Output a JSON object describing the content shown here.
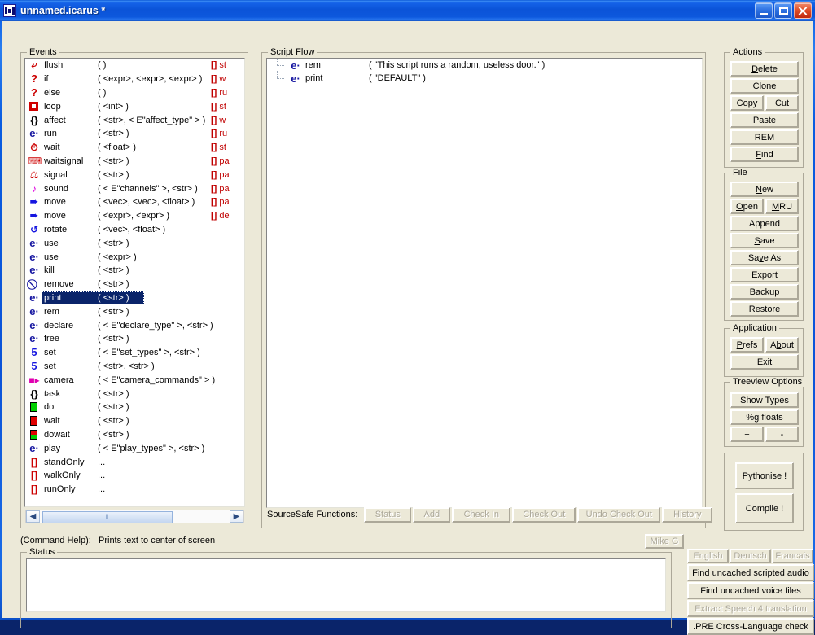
{
  "window": {
    "title": "unnamed.icarus *",
    "icon": "script-file-icon",
    "buttons": {
      "minimize": "minimize-button",
      "maximize": "maximize-button",
      "close": "close-button"
    },
    "accent_color": "#0a53d8",
    "face_color": "#ece9d8"
  },
  "events_panel": {
    "label": "Events",
    "selected_index": 17,
    "rows": [
      {
        "icon": "flush-icon",
        "name": "flush",
        "args": "(  )",
        "tail": "st"
      },
      {
        "icon": "question-icon",
        "name": "if",
        "args": "( <expr>, <expr>, <expr>  )",
        "tail": "w"
      },
      {
        "icon": "question-icon",
        "name": "else",
        "args": "(  )",
        "tail": "ru"
      },
      {
        "icon": "loop-icon",
        "name": "loop",
        "args": "( <int>  )",
        "tail": "st"
      },
      {
        "icon": "brace-icon",
        "name": "affect",
        "args": "( <str>, < E\"affect_type\" >  )",
        "tail": "w"
      },
      {
        "icon": "entity-icon",
        "name": "run",
        "args": "( <str>  )",
        "tail": "ru"
      },
      {
        "icon": "clock-icon",
        "name": "wait",
        "args": "( <float>  )",
        "tail": "st"
      },
      {
        "icon": "waitsignal-icon",
        "name": "waitsignal",
        "args": "( <str>  )",
        "tail": "pa"
      },
      {
        "icon": "signal-icon",
        "name": "signal",
        "args": "( <str>  )",
        "tail": "pa"
      },
      {
        "icon": "sound-icon",
        "name": "sound",
        "args": "( < E\"channels\" >, <str>  )",
        "tail": "pa"
      },
      {
        "icon": "move-arrow-icon",
        "name": "move",
        "args": "( <vec>, <vec>, <float>  )",
        "tail": "pa"
      },
      {
        "icon": "move-arrow-icon",
        "name": "move",
        "args": "( <expr>, <expr>  )",
        "tail": "de"
      },
      {
        "icon": "rotate-icon",
        "name": "rotate",
        "args": "( <vec>, <float>  )",
        "tail": ""
      },
      {
        "icon": "entity-icon",
        "name": "use",
        "args": "( <str>  )",
        "tail": ""
      },
      {
        "icon": "entity-icon",
        "name": "use",
        "args": "( <expr>  )",
        "tail": ""
      },
      {
        "icon": "entity-icon",
        "name": "kill",
        "args": "( <str>  )",
        "tail": ""
      },
      {
        "icon": "remove-icon",
        "name": "remove",
        "args": "( <str>  )",
        "tail": ""
      },
      {
        "icon": "entity-icon",
        "name": "print",
        "args": "( <str>  )",
        "tail": ""
      },
      {
        "icon": "entity-icon",
        "name": "rem",
        "args": "( <str>  )",
        "tail": ""
      },
      {
        "icon": "entity-icon",
        "name": "declare",
        "args": "( < E\"declare_type\" >, <str>  )",
        "tail": ""
      },
      {
        "icon": "entity-icon",
        "name": "free",
        "args": "( <str>  )",
        "tail": ""
      },
      {
        "icon": "set-icon",
        "name": "set",
        "args": "( < E\"set_types\" >, <str>  )",
        "tail": ""
      },
      {
        "icon": "set-icon",
        "name": "set",
        "args": "( <str>, <str>  )",
        "tail": ""
      },
      {
        "icon": "camera-icon",
        "name": "camera",
        "args": "( < E\"camera_commands\" >  )",
        "tail": ""
      },
      {
        "icon": "brace-icon",
        "name": "task",
        "args": "( <str>  )",
        "tail": ""
      },
      {
        "icon": "green-square-icon",
        "name": "do",
        "args": "( <str>  )",
        "tail": ""
      },
      {
        "icon": "red-square-icon",
        "name": "wait",
        "args": "( <str>  )",
        "tail": ""
      },
      {
        "icon": "half-square-icon",
        "name": "dowait",
        "args": "( <str>  )",
        "tail": ""
      },
      {
        "icon": "entity-icon",
        "name": "play",
        "args": "( < E\"play_types\" >, <str>  )",
        "tail": ""
      },
      {
        "icon": "brackets-icon",
        "name": "standOnly",
        "args": "...",
        "tail": ""
      },
      {
        "icon": "brackets-icon",
        "name": "walkOnly",
        "args": "...",
        "tail": ""
      },
      {
        "icon": "brackets-icon",
        "name": "runOnly",
        "args": "...",
        "tail": ""
      }
    ],
    "scrollbar": {
      "left_arrow": "◀",
      "right_arrow": "▶",
      "thumb": "‖"
    }
  },
  "script_flow": {
    "label": "Script Flow",
    "rows": [
      {
        "icon": "entity-icon",
        "name": "rem",
        "args": "( \"This script runs a random, useless door.\"  )"
      },
      {
        "icon": "entity-icon",
        "name": "print",
        "args": "( \"DEFAULT\"  )"
      }
    ],
    "sourcesafe": {
      "label": "SourceSafe Functions:",
      "buttons": [
        {
          "label": "Status",
          "enabled": false
        },
        {
          "label": "Add",
          "enabled": false
        },
        {
          "label": "Check In",
          "enabled": false
        },
        {
          "label": "Check Out",
          "enabled": false
        },
        {
          "label": "Undo Check Out",
          "enabled": false
        },
        {
          "label": "History",
          "enabled": false
        }
      ]
    }
  },
  "actions": {
    "label": "Actions",
    "delete": "Delete",
    "clone": "Clone",
    "copy": "Copy",
    "cut": "Cut",
    "paste": "Paste",
    "rem": "REM",
    "find": "Find"
  },
  "file": {
    "label": "File",
    "new": "New",
    "open": "Open",
    "mru": "MRU",
    "append": "Append",
    "save": "Save",
    "save_as": "Save As",
    "export": "Export",
    "backup": "Backup",
    "restore": "Restore"
  },
  "application": {
    "label": "Application",
    "prefs": "Prefs",
    "about": "About",
    "exit": "Exit"
  },
  "treeview": {
    "label": "Treeview Options",
    "show_types": "Show Types",
    "g_floats": "%g floats",
    "plus": "+",
    "minus": "-"
  },
  "run": {
    "pythonise": "Pythonise !",
    "compile": "Compile !"
  },
  "command_help": {
    "label": "(Command Help):",
    "text": "Prints text to center of screen"
  },
  "status": {
    "label": "Status",
    "text": ""
  },
  "bottom_right": {
    "mike_g": {
      "label": "Mike G",
      "enabled": false
    },
    "languages": [
      {
        "label": "English",
        "enabled": false
      },
      {
        "label": "Deutsch",
        "enabled": false
      },
      {
        "label": "Francais",
        "enabled": false
      }
    ],
    "find_uncached_scripted_audio": {
      "label": "Find uncached scripted audio",
      "enabled": true
    },
    "find_uncached_voice_files": {
      "label": "Find uncached voice files",
      "enabled": true
    },
    "extract_speech": {
      "label": "Extract Speech 4 translation",
      "enabled": false
    },
    "pre_cross_language": {
      "label": ".PRE Cross-Language check",
      "enabled": true
    }
  }
}
